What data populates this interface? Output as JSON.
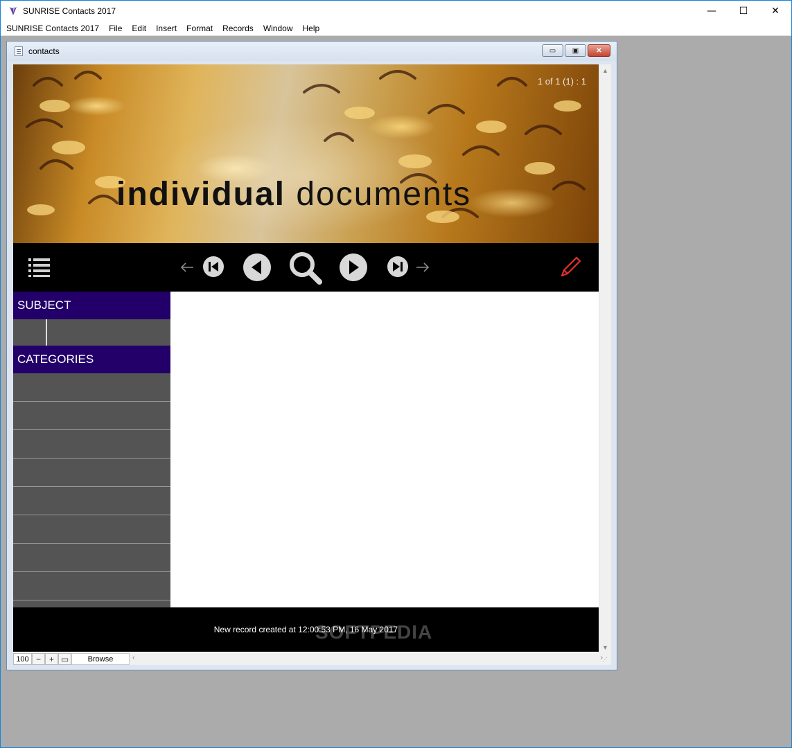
{
  "app": {
    "title": "SUNRISE Contacts 2017",
    "window_controls": {
      "minimize": "—",
      "maximize": "☐",
      "close": "✕"
    }
  },
  "menu": {
    "items": [
      "SUNRISE Contacts 2017",
      "File",
      "Edit",
      "Insert",
      "Format",
      "Records",
      "Window",
      "Help"
    ]
  },
  "child_window": {
    "title": "contacts"
  },
  "banner": {
    "record_counter": "1 of 1 (1) : 1",
    "title_bold": "individual",
    "title_rest": "documents"
  },
  "navbar": {
    "icons": [
      "list-icon",
      "arrow-left-icon",
      "first-record-icon",
      "previous-record-icon",
      "search-icon",
      "next-record-icon",
      "last-record-icon",
      "arrow-right-icon",
      "pencil-icon"
    ],
    "accent_color": "#e0332a"
  },
  "left_panel": {
    "subject_label": "SUBJECT",
    "categories_label": "CATEGORIES",
    "header_color": "#230069",
    "category_rows": 8
  },
  "status": {
    "message": "New record created at 12:00:53 PM, 16 May 2017",
    "watermark": "SOFTPEDIA"
  },
  "bottom_bar": {
    "zoom": "100",
    "zoom_out": "−",
    "zoom_in": "+",
    "mode": "Browse"
  }
}
